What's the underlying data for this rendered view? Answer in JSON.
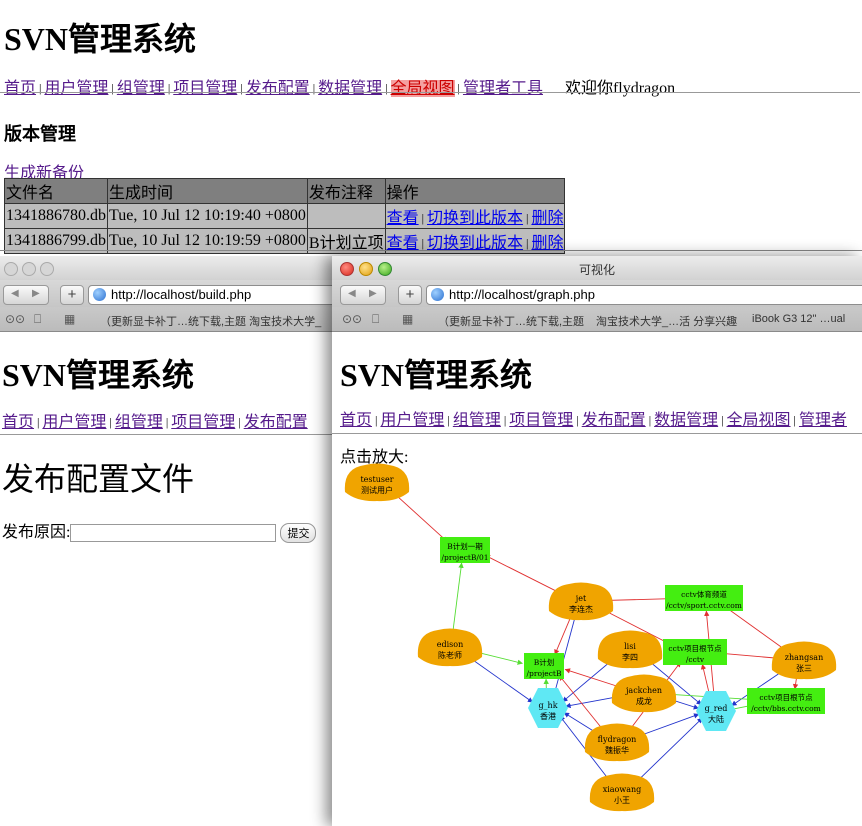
{
  "top": {
    "title": "SVN管理系统",
    "nav": [
      "首页",
      "用户管理",
      "组管理",
      "项目管理",
      "发布配置",
      "数据管理",
      "全局视图",
      "管理者工具"
    ],
    "welcome": "欢迎你flydragon",
    "section_title": "版本管理",
    "new_backup": "生成新备份",
    "table": {
      "headers": [
        "文件名",
        "生成时间",
        "发布注释",
        "操作"
      ],
      "rows": [
        {
          "file": "1341886780.db",
          "time": "Tue, 10 Jul 12 10:19:40 +0800",
          "note": "",
          "view": "查看",
          "switch": "切换到此版本",
          "delete": "删除"
        },
        {
          "file": "1341886799.db",
          "time": "Tue, 10 Jul 12 10:19:59 +0800",
          "note": "B计划立项",
          "view": "查看",
          "switch": "切换到此版本",
          "delete": "删除"
        }
      ]
    }
  },
  "left_window": {
    "url": "http://localhost/build.php",
    "bookmark": "（更新显卡补丁…统下载,主题     淘宝技术大学_",
    "page_title": "SVN管理系统",
    "nav": [
      "首页",
      "用户管理",
      "组管理",
      "项目管理",
      "发布配置"
    ],
    "heading": "发布配置文件",
    "form_label": "发布原因:",
    "submit": "提交"
  },
  "right_window": {
    "window_title": "可视化",
    "url": "http://localhost/graph.php",
    "bookmarks": [
      "（更新显卡补丁…统下载,主题",
      "淘宝技术大学_…活 分享兴趣",
      "iBook G3 12\" …ual"
    ],
    "page_title": "SVN管理系统",
    "nav": [
      "首页",
      "用户管理",
      "组管理",
      "项目管理",
      "发布配置",
      "数据管理",
      "全局视图",
      "管理者"
    ],
    "hint": "点击放大:",
    "graph": {
      "users": [
        {
          "id": "testuser",
          "l1": "testuser",
          "l2": "测试用户"
        },
        {
          "id": "jet",
          "l1": "jet",
          "l2": "李连杰"
        },
        {
          "id": "edison",
          "l1": "edison",
          "l2": "陈老师"
        },
        {
          "id": "lisi",
          "l1": "lisi",
          "l2": "李四"
        },
        {
          "id": "zhangsan",
          "l1": "zhangsan",
          "l2": "张三"
        },
        {
          "id": "jackchen",
          "l1": "jackchen",
          "l2": "成龙"
        },
        {
          "id": "flydragon",
          "l1": "flydragon",
          "l2": "魏振华"
        },
        {
          "id": "xiaowang",
          "l1": "xiaowang",
          "l2": "小王"
        }
      ],
      "groups": [
        {
          "id": "g_hk",
          "l1": "g_hk",
          "l2": "香港"
        },
        {
          "id": "g_red",
          "l1": "g_red",
          "l2": "大陆"
        }
      ],
      "projects": [
        {
          "id": "pB01",
          "l1": "B计划一期",
          "l2": "/projectB/01"
        },
        {
          "id": "sport",
          "l1": "cctv体育频道",
          "l2": "/cctv/sport.cctv.com"
        },
        {
          "id": "pB",
          "l1": "B计划",
          "l2": "/projectB"
        },
        {
          "id": "cctv",
          "l1": "cctv项目根节点",
          "l2": "/cctv"
        },
        {
          "id": "bbs",
          "l1": "cctv项目根节点",
          "l2": "/cctv/bbs.cctv.com"
        }
      ]
    }
  },
  "colors": {
    "user": "#f0a400",
    "group": "#5fe8f4",
    "project": "#44ee11",
    "red_edge": "#e03030",
    "blue_edge": "#2233cc",
    "green_edge": "#55dd33",
    "active_nav": "#f4a0a0"
  }
}
